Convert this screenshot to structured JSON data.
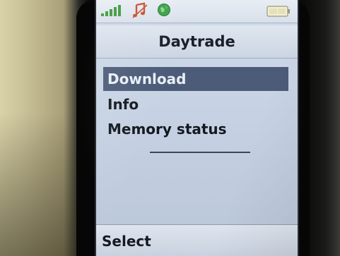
{
  "screen": {
    "title": "Daytrade",
    "menu_items": [
      {
        "label": "Download",
        "selected": true
      },
      {
        "label": "Info",
        "selected": false
      },
      {
        "label": "Memory status",
        "selected": false
      }
    ],
    "softkey_left": "Select"
  },
  "status_icons": [
    "signal-icon",
    "music-icon",
    "globe-icon",
    "battery-icon"
  ],
  "colors": {
    "screen_bg": "#c6d2e3",
    "selection_bg": "#4c5b78",
    "text": "#131820",
    "signal": "#3a9a3a",
    "music": "#c8502c",
    "globe": "#3aa34a"
  }
}
